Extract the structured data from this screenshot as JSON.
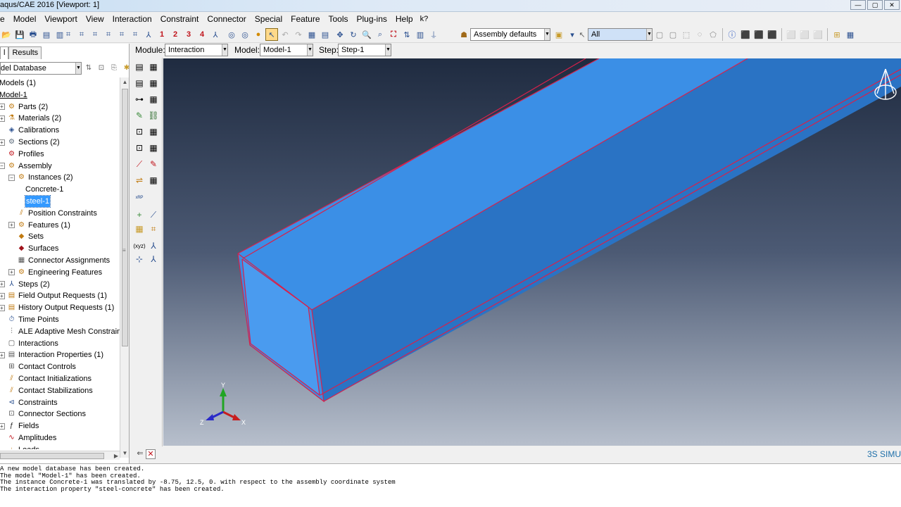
{
  "window": {
    "title": "aqus/CAE 2016 [Viewport: 1]",
    "buttons": [
      "—",
      "▢",
      "✕"
    ]
  },
  "menu": [
    "e",
    "Model",
    "Viewport",
    "View",
    "Interaction",
    "Constraint",
    "Connector",
    "Special",
    "Feature",
    "Tools",
    "Plug-ins",
    "Help",
    "k?"
  ],
  "toolbar": {
    "view_numbers": [
      "1",
      "2",
      "3",
      "4"
    ],
    "render_style": "Assembly defaults",
    "selection_filter": "All"
  },
  "left_panel": {
    "tabs": [
      "l",
      "Results"
    ],
    "database": "del Database"
  },
  "tree": [
    {
      "label": "Models (1)",
      "icon": "none"
    },
    {
      "label": "Model-1",
      "icon": "none",
      "underline": true
    },
    {
      "label": "Parts (2)",
      "icon": "parts-icon",
      "exp": "+"
    },
    {
      "label": "Materials (2)",
      "icon": "materials-icon",
      "exp": "+"
    },
    {
      "label": "Calibrations",
      "icon": "calibrations-icon"
    },
    {
      "label": "Sections (2)",
      "icon": "sections-icon",
      "exp": "+"
    },
    {
      "label": "Profiles",
      "icon": "profiles-icon"
    },
    {
      "label": "Assembly",
      "icon": "assembly-icon",
      "exp": "−"
    },
    {
      "label": "Instances (2)",
      "icon": "instances-icon",
      "exp": "−"
    },
    {
      "label": "Concrete-1",
      "icon": "none"
    },
    {
      "label": "steel-1",
      "icon": "none",
      "selected": true
    },
    {
      "label": "Position Constraints",
      "icon": "position-constraints-icon"
    },
    {
      "label": "Features (1)",
      "icon": "features-icon",
      "exp": "+"
    },
    {
      "label": "Sets",
      "icon": "sets-icon"
    },
    {
      "label": "Surfaces",
      "icon": "surfaces-icon"
    },
    {
      "label": "Connector Assignments",
      "icon": "connector-assignments-icon"
    },
    {
      "label": "Engineering Features",
      "icon": "engineering-features-icon",
      "exp": "+"
    },
    {
      "label": "Steps (2)",
      "icon": "steps-icon",
      "exp": "+"
    },
    {
      "label": "Field Output Requests (1)",
      "icon": "field-output-icon",
      "exp": "+"
    },
    {
      "label": "History Output Requests (1)",
      "icon": "history-output-icon",
      "exp": "+"
    },
    {
      "label": "Time Points",
      "icon": "time-points-icon"
    },
    {
      "label": "ALE Adaptive Mesh Constraints",
      "icon": "ale-icon"
    },
    {
      "label": "Interactions",
      "icon": "interactions-icon"
    },
    {
      "label": "Interaction Properties (1)",
      "icon": "interaction-properties-icon",
      "exp": "+"
    },
    {
      "label": "Contact Controls",
      "icon": "contact-controls-icon"
    },
    {
      "label": "Contact Initializations",
      "icon": "contact-initializations-icon"
    },
    {
      "label": "Contact Stabilizations",
      "icon": "contact-stabilizations-icon"
    },
    {
      "label": "Constraints",
      "icon": "constraints-icon"
    },
    {
      "label": "Connector Sections",
      "icon": "connector-sections-icon"
    },
    {
      "label": "Fields",
      "icon": "fields-icon",
      "exp": "+"
    },
    {
      "label": "Amplitudes",
      "icon": "amplitudes-icon"
    },
    {
      "label": "Loads",
      "icon": "loads-icon"
    }
  ],
  "context": {
    "module_label": "Module:",
    "module_value": "Interaction",
    "model_label": "Model:",
    "model_value": "Model-1",
    "step_label": "Step:",
    "step_value": "Step-1"
  },
  "viewport": {
    "triad": {
      "x": "X",
      "y": "Y",
      "z": "Z"
    },
    "edge_color": "#d8204a",
    "beam_color": "#3a8fe0"
  },
  "brand": "3S SIMU",
  "messages": [
    "A new model database has been created.",
    "The model \"Model-1\" has been created.",
    "The instance Concrete-1 was translated by -8.75, 12.5, 0. with respect to the assembly coordinate system",
    "The interaction property \"steel-concrete\" has been created."
  ]
}
